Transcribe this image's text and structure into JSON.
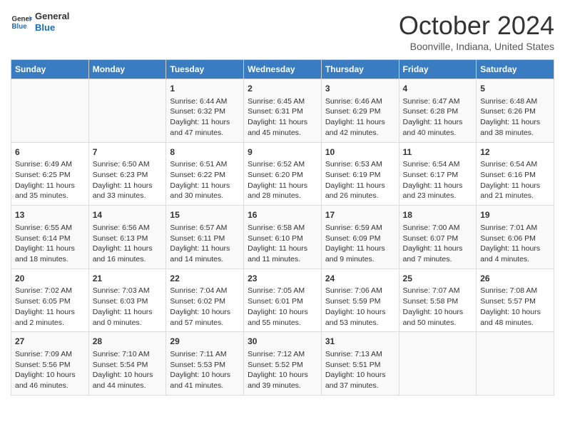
{
  "header": {
    "logo_line1": "General",
    "logo_line2": "Blue",
    "month": "October 2024",
    "location": "Boonville, Indiana, United States"
  },
  "days_of_week": [
    "Sunday",
    "Monday",
    "Tuesday",
    "Wednesday",
    "Thursday",
    "Friday",
    "Saturday"
  ],
  "weeks": [
    [
      {
        "day": "",
        "content": ""
      },
      {
        "day": "",
        "content": ""
      },
      {
        "day": "1",
        "content": "Sunrise: 6:44 AM\nSunset: 6:32 PM\nDaylight: 11 hours and 47 minutes."
      },
      {
        "day": "2",
        "content": "Sunrise: 6:45 AM\nSunset: 6:31 PM\nDaylight: 11 hours and 45 minutes."
      },
      {
        "day": "3",
        "content": "Sunrise: 6:46 AM\nSunset: 6:29 PM\nDaylight: 11 hours and 42 minutes."
      },
      {
        "day": "4",
        "content": "Sunrise: 6:47 AM\nSunset: 6:28 PM\nDaylight: 11 hours and 40 minutes."
      },
      {
        "day": "5",
        "content": "Sunrise: 6:48 AM\nSunset: 6:26 PM\nDaylight: 11 hours and 38 minutes."
      }
    ],
    [
      {
        "day": "6",
        "content": "Sunrise: 6:49 AM\nSunset: 6:25 PM\nDaylight: 11 hours and 35 minutes."
      },
      {
        "day": "7",
        "content": "Sunrise: 6:50 AM\nSunset: 6:23 PM\nDaylight: 11 hours and 33 minutes."
      },
      {
        "day": "8",
        "content": "Sunrise: 6:51 AM\nSunset: 6:22 PM\nDaylight: 11 hours and 30 minutes."
      },
      {
        "day": "9",
        "content": "Sunrise: 6:52 AM\nSunset: 6:20 PM\nDaylight: 11 hours and 28 minutes."
      },
      {
        "day": "10",
        "content": "Sunrise: 6:53 AM\nSunset: 6:19 PM\nDaylight: 11 hours and 26 minutes."
      },
      {
        "day": "11",
        "content": "Sunrise: 6:54 AM\nSunset: 6:17 PM\nDaylight: 11 hours and 23 minutes."
      },
      {
        "day": "12",
        "content": "Sunrise: 6:54 AM\nSunset: 6:16 PM\nDaylight: 11 hours and 21 minutes."
      }
    ],
    [
      {
        "day": "13",
        "content": "Sunrise: 6:55 AM\nSunset: 6:14 PM\nDaylight: 11 hours and 18 minutes."
      },
      {
        "day": "14",
        "content": "Sunrise: 6:56 AM\nSunset: 6:13 PM\nDaylight: 11 hours and 16 minutes."
      },
      {
        "day": "15",
        "content": "Sunrise: 6:57 AM\nSunset: 6:11 PM\nDaylight: 11 hours and 14 minutes."
      },
      {
        "day": "16",
        "content": "Sunrise: 6:58 AM\nSunset: 6:10 PM\nDaylight: 11 hours and 11 minutes."
      },
      {
        "day": "17",
        "content": "Sunrise: 6:59 AM\nSunset: 6:09 PM\nDaylight: 11 hours and 9 minutes."
      },
      {
        "day": "18",
        "content": "Sunrise: 7:00 AM\nSunset: 6:07 PM\nDaylight: 11 hours and 7 minutes."
      },
      {
        "day": "19",
        "content": "Sunrise: 7:01 AM\nSunset: 6:06 PM\nDaylight: 11 hours and 4 minutes."
      }
    ],
    [
      {
        "day": "20",
        "content": "Sunrise: 7:02 AM\nSunset: 6:05 PM\nDaylight: 11 hours and 2 minutes."
      },
      {
        "day": "21",
        "content": "Sunrise: 7:03 AM\nSunset: 6:03 PM\nDaylight: 11 hours and 0 minutes."
      },
      {
        "day": "22",
        "content": "Sunrise: 7:04 AM\nSunset: 6:02 PM\nDaylight: 10 hours and 57 minutes."
      },
      {
        "day": "23",
        "content": "Sunrise: 7:05 AM\nSunset: 6:01 PM\nDaylight: 10 hours and 55 minutes."
      },
      {
        "day": "24",
        "content": "Sunrise: 7:06 AM\nSunset: 5:59 PM\nDaylight: 10 hours and 53 minutes."
      },
      {
        "day": "25",
        "content": "Sunrise: 7:07 AM\nSunset: 5:58 PM\nDaylight: 10 hours and 50 minutes."
      },
      {
        "day": "26",
        "content": "Sunrise: 7:08 AM\nSunset: 5:57 PM\nDaylight: 10 hours and 48 minutes."
      }
    ],
    [
      {
        "day": "27",
        "content": "Sunrise: 7:09 AM\nSunset: 5:56 PM\nDaylight: 10 hours and 46 minutes."
      },
      {
        "day": "28",
        "content": "Sunrise: 7:10 AM\nSunset: 5:54 PM\nDaylight: 10 hours and 44 minutes."
      },
      {
        "day": "29",
        "content": "Sunrise: 7:11 AM\nSunset: 5:53 PM\nDaylight: 10 hours and 41 minutes."
      },
      {
        "day": "30",
        "content": "Sunrise: 7:12 AM\nSunset: 5:52 PM\nDaylight: 10 hours and 39 minutes."
      },
      {
        "day": "31",
        "content": "Sunrise: 7:13 AM\nSunset: 5:51 PM\nDaylight: 10 hours and 37 minutes."
      },
      {
        "day": "",
        "content": ""
      },
      {
        "day": "",
        "content": ""
      }
    ]
  ]
}
